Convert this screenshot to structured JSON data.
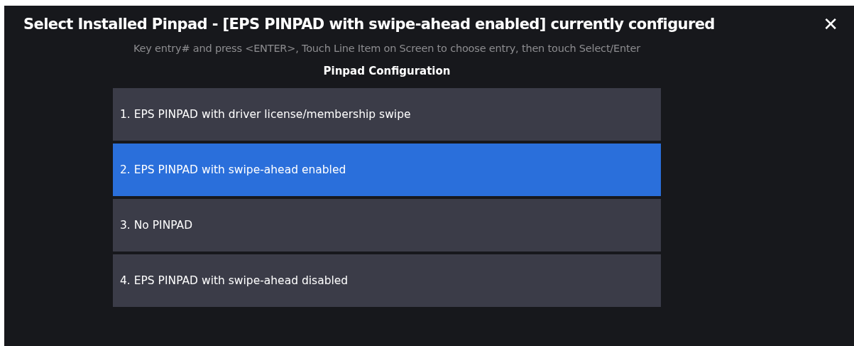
{
  "window": {
    "title": "Select Installed Pinpad - [EPS PINPAD with swipe-ahead enabled] currently configured",
    "close": "✕"
  },
  "instructions": "Key entry# and press <ENTER>, Touch Line Item on Screen to choose entry, then touch Select/Enter",
  "list": {
    "heading": "Pinpad Configuration",
    "items": [
      {
        "label": "1. EPS PINPAD with driver license/membership swipe",
        "selected": false
      },
      {
        "label": "2. EPS PINPAD with swipe-ahead enabled",
        "selected": true
      },
      {
        "label": "3. No PINPAD",
        "selected": false
      },
      {
        "label": "4. EPS PINPAD with swipe-ahead disabled",
        "selected": false
      }
    ]
  }
}
